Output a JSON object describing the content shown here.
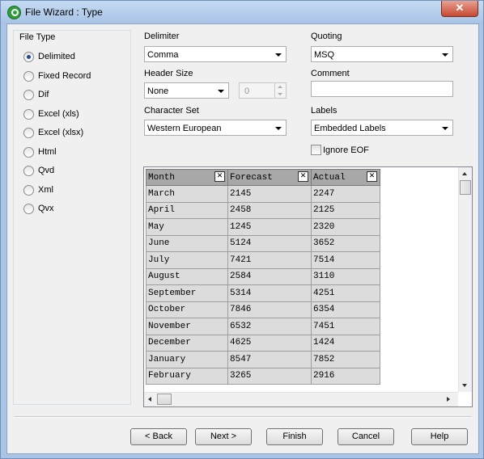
{
  "window": {
    "title": "File Wizard : Type",
    "close_glyph": "✕"
  },
  "file_type": {
    "title": "File Type",
    "options": [
      {
        "label": "Delimited",
        "selected": true
      },
      {
        "label": "Fixed Record",
        "selected": false
      },
      {
        "label": "Dif",
        "selected": false
      },
      {
        "label": "Excel (xls)",
        "selected": false
      },
      {
        "label": "Excel (xlsx)",
        "selected": false
      },
      {
        "label": "Html",
        "selected": false
      },
      {
        "label": "Qvd",
        "selected": false
      },
      {
        "label": "Xml",
        "selected": false
      },
      {
        "label": "Qvx",
        "selected": false
      }
    ]
  },
  "delimiter": {
    "label": "Delimiter",
    "value": "Comma"
  },
  "quoting": {
    "label": "Quoting",
    "value": "MSQ"
  },
  "header_size": {
    "label": "Header Size",
    "value": "None",
    "spin_value": "0"
  },
  "comment": {
    "label": "Comment",
    "value": ""
  },
  "character_set": {
    "label": "Character Set",
    "value": "Western European"
  },
  "labels": {
    "label": "Labels",
    "value": "Embedded Labels"
  },
  "ignore_eof": {
    "label": "Ignore EOF",
    "checked": false
  },
  "preview": {
    "columns": [
      "Month",
      "Forecast",
      "Actual"
    ],
    "column_close_glyph": "✕",
    "rows": [
      [
        "March",
        "2145",
        "2247"
      ],
      [
        "April",
        "2458",
        "2125"
      ],
      [
        "May",
        "1245",
        "2320"
      ],
      [
        "June",
        "5124",
        "3652"
      ],
      [
        "July",
        "7421",
        "7514"
      ],
      [
        "August",
        "2584",
        "3110"
      ],
      [
        "September",
        "5314",
        "4251"
      ],
      [
        "October",
        "7846",
        "6354"
      ],
      [
        "November",
        "6532",
        "7451"
      ],
      [
        "December",
        "4625",
        "1424"
      ],
      [
        "January",
        "8547",
        "7852"
      ],
      [
        "February",
        "3265",
        "2916"
      ]
    ]
  },
  "buttons": {
    "back": "< Back",
    "next": "Next >",
    "finish": "Finish",
    "cancel": "Cancel",
    "help": "Help"
  }
}
